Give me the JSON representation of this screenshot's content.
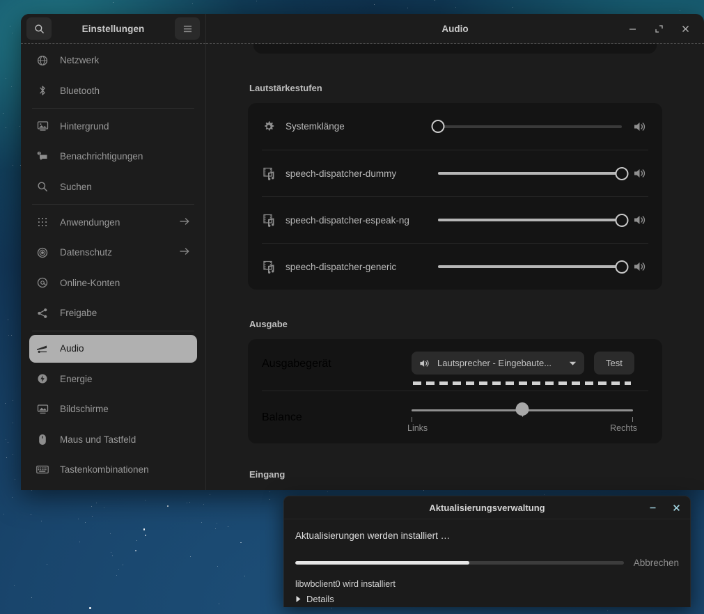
{
  "desktop": {
    "wallpaper": "starfield-blue",
    "accent": "#13899a"
  },
  "settings_window": {
    "sidebar": {
      "search_icon": "search-icon",
      "title": "Einstellungen",
      "menu_icon": "hamburger-menu-icon",
      "items": [
        {
          "label": "Netzwerk",
          "icon": "globe-icon",
          "active": false,
          "arrow": false
        },
        {
          "label": "Bluetooth",
          "icon": "bluetooth-icon",
          "active": false,
          "arrow": false
        },
        {
          "label": "Hintergrund",
          "icon": "wallpaper-icon",
          "active": false,
          "arrow": false
        },
        {
          "label": "Benachrichtigungen",
          "icon": "notification-icon",
          "active": false,
          "arrow": false
        },
        {
          "label": "Suchen",
          "icon": "search-icon",
          "active": false,
          "arrow": false
        },
        {
          "label": "Anwendungen",
          "icon": "apps-grid-icon",
          "active": false,
          "arrow": true
        },
        {
          "label": "Datenschutz",
          "icon": "privacy-shutter-icon",
          "active": false,
          "arrow": true
        },
        {
          "label": "Online-Konten",
          "icon": "at-sign-icon",
          "active": false,
          "arrow": false
        },
        {
          "label": "Freigabe",
          "icon": "share-icon",
          "active": false,
          "arrow": false
        },
        {
          "label": "Audio",
          "icon": "audio-icon",
          "active": true,
          "arrow": false
        },
        {
          "label": "Energie",
          "icon": "power-bolt-icon",
          "active": false,
          "arrow": false
        },
        {
          "label": "Bildschirme",
          "icon": "display-icon",
          "active": false,
          "arrow": false
        },
        {
          "label": "Maus und Tastfeld",
          "icon": "mouse-icon",
          "active": false,
          "arrow": false
        },
        {
          "label": "Tastenkombinationen",
          "icon": "keyboard-icon",
          "active": false,
          "arrow": false
        }
      ]
    },
    "titlebar": {
      "title": "Audio",
      "minimize_icon": "minimize-icon",
      "maximize_icon": "maximize-icon",
      "close_icon": "close-icon"
    },
    "content": {
      "volume_section": {
        "heading": "Lautstärkestufen",
        "rows": [
          {
            "name": "Systemklänge",
            "icon": "gear-icon",
            "value": 0,
            "speaker_icon": "speaker-icon"
          },
          {
            "name": "speech-dispatcher-dummy",
            "icon": "multimedia-icon",
            "value": 100,
            "speaker_icon": "speaker-icon"
          },
          {
            "name": "speech-dispatcher-espeak-ng",
            "icon": "multimedia-icon",
            "value": 100,
            "speaker_icon": "speaker-icon"
          },
          {
            "name": "speech-dispatcher-generic",
            "icon": "multimedia-icon",
            "value": 100,
            "speaker_icon": "speaker-icon"
          }
        ]
      },
      "output_section": {
        "heading": "Ausgabe",
        "device_label": "Ausgabegerät",
        "device_value": "Lautsprecher - Eingebaute...",
        "device_icon": "speaker-icon",
        "device_dropdown_icon": "chevron-down-icon",
        "test_label": "Test",
        "balance_label": "Balance",
        "balance_value": 50,
        "balance_min_label": "Links",
        "balance_max_label": "Rechts"
      },
      "input_section": {
        "heading": "Eingang"
      }
    }
  },
  "update_dialog": {
    "title": "Aktualisierungsverwaltung",
    "minimize_icon": "minimize-icon",
    "close_icon": "close-icon",
    "message": "Aktualisierungen werden installiert …",
    "progress_percent": 53,
    "cancel_label": "Abbrechen",
    "status": "libwbclient0 wird installiert",
    "details_label": "Details",
    "details_icon": "triangle-right-icon"
  }
}
